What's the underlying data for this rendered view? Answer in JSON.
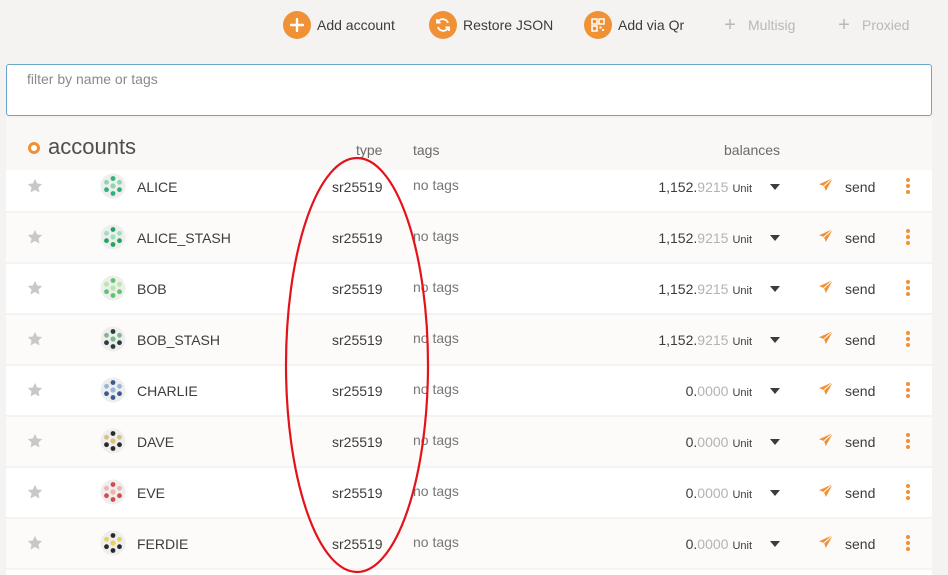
{
  "toolbar": {
    "add_account": "Add account",
    "restore_json": "Restore JSON",
    "add_via_qr": "Add via Qr",
    "multisig": "Multisig",
    "proxied": "Proxied"
  },
  "filter": {
    "placeholder": "filter by name or tags"
  },
  "table": {
    "title": "accounts",
    "col_type": "type",
    "col_tags": "tags",
    "col_balances": "balances",
    "send_label": "send",
    "accent_color": "#f19135"
  },
  "accounts": [
    {
      "name": "ALICE",
      "type": "sr25519",
      "tags": "no tags",
      "balance_int": "1,152.",
      "balance_dec": "9215",
      "unit": "Unit"
    },
    {
      "name": "ALICE_STASH",
      "type": "sr25519",
      "tags": "no tags",
      "balance_int": "1,152.",
      "balance_dec": "9215",
      "unit": "Unit"
    },
    {
      "name": "BOB",
      "type": "sr25519",
      "tags": "no tags",
      "balance_int": "1,152.",
      "balance_dec": "9215",
      "unit": "Unit"
    },
    {
      "name": "BOB_STASH",
      "type": "sr25519",
      "tags": "no tags",
      "balance_int": "1,152.",
      "balance_dec": "9215",
      "unit": "Unit"
    },
    {
      "name": "CHARLIE",
      "type": "sr25519",
      "tags": "no tags",
      "balance_int": "0.",
      "balance_dec": "0000",
      "unit": "Unit"
    },
    {
      "name": "DAVE",
      "type": "sr25519",
      "tags": "no tags",
      "balance_int": "0.",
      "balance_dec": "0000",
      "unit": "Unit"
    },
    {
      "name": "EVE",
      "type": "sr25519",
      "tags": "no tags",
      "balance_int": "0.",
      "balance_dec": "0000",
      "unit": "Unit"
    },
    {
      "name": "FERDIE",
      "type": "sr25519",
      "tags": "no tags",
      "balance_int": "0.",
      "balance_dec": "0000",
      "unit": "Unit"
    }
  ],
  "avatar_colors": [
    [
      "#2fb37a",
      "#8fd6b0"
    ],
    [
      "#27a35f",
      "#9fe0b8"
    ],
    [
      "#5fc46a",
      "#b6e9a4"
    ],
    [
      "#2c3a3a",
      "#7fb88a"
    ],
    [
      "#3d5a8c",
      "#9ab6d8"
    ],
    [
      "#2a2a2a",
      "#d9c27a"
    ],
    [
      "#d64a4a",
      "#f2b0b0"
    ],
    [
      "#2a2a2a",
      "#e8d35a"
    ]
  ]
}
